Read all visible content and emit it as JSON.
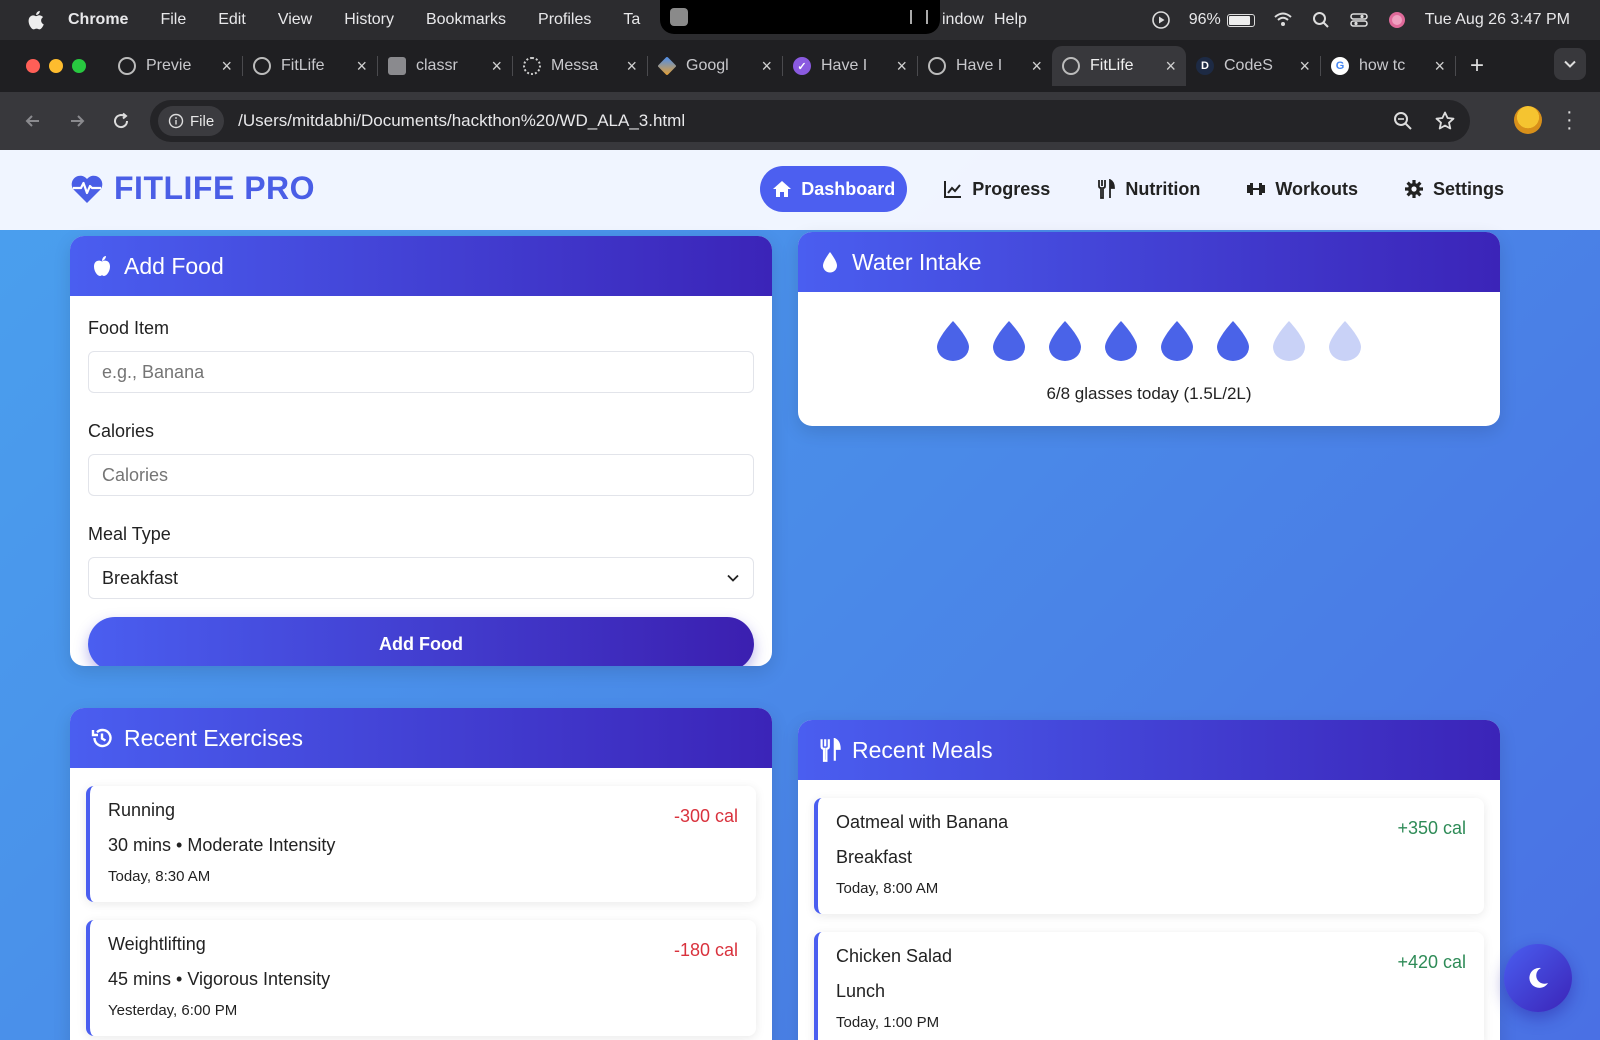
{
  "menubar": {
    "app": "Chrome",
    "items": [
      "File",
      "Edit",
      "View",
      "History",
      "Bookmarks",
      "Profiles",
      "Ta",
      "indow",
      "Help"
    ],
    "battery": "96%",
    "datetime": "Tue Aug 26  3:47 PM"
  },
  "tabs": [
    {
      "title": "Previe",
      "icon": "globe-icon"
    },
    {
      "title": "FitLife",
      "icon": "globe-icon"
    },
    {
      "title": "classr",
      "icon": "classroom-icon"
    },
    {
      "title": "Messa",
      "icon": "chatgpt-icon"
    },
    {
      "title": "Googl",
      "icon": "gemini-icon"
    },
    {
      "title": "Have I",
      "icon": "check-badge-icon"
    },
    {
      "title": "Have I",
      "icon": "globe-icon"
    },
    {
      "title": "FitLife",
      "icon": "globe-icon",
      "active": true
    },
    {
      "title": "CodeS",
      "icon": "d-letter-icon"
    },
    {
      "title": "how tc",
      "icon": "google-icon"
    }
  ],
  "address": {
    "chip": "File",
    "url": "/Users/mitdabhi/Documents/hackthon%20/WD_ALA_3.html"
  },
  "app": {
    "brand": "FITLIFE PRO",
    "nav": [
      {
        "label": "Dashboard",
        "icon": "home-icon",
        "active": true
      },
      {
        "label": "Progress",
        "icon": "chart-line-icon"
      },
      {
        "label": "Nutrition",
        "icon": "utensils-icon"
      },
      {
        "label": "Workouts",
        "icon": "dumbbell-icon"
      },
      {
        "label": "Settings",
        "icon": "gear-icon"
      }
    ]
  },
  "add_food": {
    "title": "Add Food",
    "food_label": "Food Item",
    "food_placeholder": "e.g., Banana",
    "calories_label": "Calories",
    "calories_placeholder": "Calories",
    "meal_label": "Meal Type",
    "meal_value": "Breakfast",
    "submit": "Add Food"
  },
  "water": {
    "title": "Water Intake",
    "filled": 6,
    "total": 8,
    "summary": "6/8 glasses today (1.5L/2L)"
  },
  "exercises": {
    "title": "Recent Exercises",
    "items": [
      {
        "name": "Running",
        "detail": "30 mins • Moderate Intensity",
        "time": "Today, 8:30 AM",
        "cal": "-300 cal"
      },
      {
        "name": "Weightlifting",
        "detail": "45 mins • Vigorous Intensity",
        "time": "Yesterday, 6:00 PM",
        "cal": "-180 cal"
      }
    ]
  },
  "meals": {
    "title": "Recent Meals",
    "items": [
      {
        "name": "Oatmeal with Banana",
        "detail": "Breakfast",
        "time": "Today, 8:00 AM",
        "cal": "+350 cal"
      },
      {
        "name": "Chicken Salad",
        "detail": "Lunch",
        "time": "Today, 1:00 PM",
        "cal": "+420 cal"
      }
    ]
  },
  "colors": {
    "accent": "#4a5ef0",
    "accent_dark": "#3b24b8",
    "water_filled": "#4a63e8",
    "water_empty": "#c9d2f7",
    "negative": "#d9323d",
    "positive": "#2e8b57"
  }
}
